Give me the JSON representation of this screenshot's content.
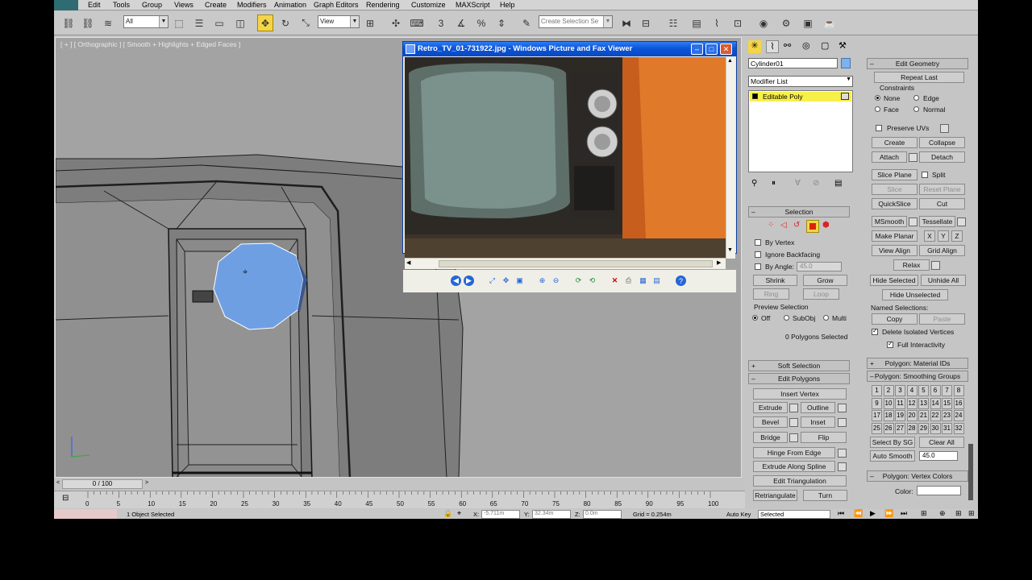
{
  "menu": [
    "Edit",
    "Tools",
    "Group",
    "Views",
    "Create",
    "Modifiers",
    "Animation",
    "Graph Editors",
    "Rendering",
    "Customize",
    "MAXScript",
    "Help"
  ],
  "toolbar": {
    "filter_value": "All",
    "refcoord_value": "View",
    "selection_set_placeholder": "Create Selection Se"
  },
  "viewport": {
    "label": "[ + ] [ Orthographic ] [ Smooth + Highlights + Edged Faces ]"
  },
  "picture_viewer": {
    "title": "Retro_TV_01-731922.jpg - Windows Picture and Fax Viewer"
  },
  "command_panel": {
    "object_name": "Cylinder01",
    "modifier_list": "Modifier List",
    "stack_item": "Editable Poly",
    "selection": {
      "header": "Selection",
      "by_vertex": "By Vertex",
      "ignore_backfacing": "Ignore Backfacing",
      "by_angle": "By Angle:",
      "by_angle_value": "45.0",
      "shrink": "Shrink",
      "grow": "Grow",
      "ring": "Ring",
      "loop": "Loop",
      "preview_selection": "Preview Selection",
      "preview_off": "Off",
      "preview_subobj": "SubObj",
      "preview_multi": "Multi",
      "status": "0 Polygons Selected"
    },
    "soft_selection": "Soft Selection",
    "edit_polygons": {
      "header": "Edit Polygons",
      "insert_vertex": "Insert Vertex",
      "extrude": "Extrude",
      "outline": "Outline",
      "bevel": "Bevel",
      "inset": "Inset",
      "bridge": "Bridge",
      "flip": "Flip",
      "hinge": "Hinge From Edge",
      "extrude_spline": "Extrude Along Spline",
      "edit_triangulation": "Edit Triangulation",
      "retriangulate": "Retriangulate",
      "turn": "Turn"
    },
    "edit_geometry": {
      "header": "Edit Geometry",
      "repeat_last": "Repeat Last",
      "constraints": "Constraints",
      "c_none": "None",
      "c_edge": "Edge",
      "c_face": "Face",
      "c_normal": "Normal",
      "preserve_uvs": "Preserve UVs",
      "create": "Create",
      "collapse": "Collapse",
      "attach": "Attach",
      "detach": "Detach",
      "slice_plane": "Slice Plane",
      "split": "Split",
      "slice": "Slice",
      "reset_plane": "Reset Plane",
      "quickslice": "QuickSlice",
      "cut": "Cut",
      "msmooth": "MSmooth",
      "tessellate": "Tessellate",
      "make_planar": "Make Planar",
      "x": "X",
      "y": "Y",
      "z": "Z",
      "view_align": "View Align",
      "grid_align": "Grid Align",
      "relax": "Relax",
      "hide_selected": "Hide Selected",
      "unhide_all": "Unhide All",
      "hide_unselected": "Hide Unselected",
      "named_selections": "Named Selections:",
      "copy": "Copy",
      "paste": "Paste",
      "delete_isolated": "Delete Isolated Vertices",
      "full_interactivity": "Full Interactivity"
    },
    "material_ids": "Polygon: Material IDs",
    "smoothing_groups": {
      "header": "Polygon: Smoothing Groups",
      "numbers": [
        "1",
        "2",
        "3",
        "4",
        "5",
        "6",
        "7",
        "8",
        "9",
        "10",
        "11",
        "12",
        "13",
        "14",
        "15",
        "16",
        "17",
        "18",
        "19",
        "20",
        "21",
        "22",
        "23",
        "24",
        "25",
        "26",
        "27",
        "28",
        "29",
        "30",
        "31",
        "32"
      ],
      "select_by_sg": "Select By SG",
      "clear_all": "Clear All",
      "auto_smooth": "Auto Smooth",
      "auto_smooth_value": "45.0"
    },
    "vertex_colors": {
      "header": "Polygon: Vertex Colors",
      "color": "Color:"
    }
  },
  "timeline": {
    "frame": "0 / 100",
    "ticks": [
      "0",
      "5",
      "10",
      "15",
      "20",
      "25",
      "30",
      "35",
      "40",
      "45",
      "50",
      "55",
      "60",
      "65",
      "70",
      "75",
      "80",
      "85",
      "90",
      "95",
      "100"
    ]
  },
  "status": {
    "selected": "1 Object Selected",
    "x_label": "X:",
    "x_value": "-5.711m",
    "y_label": "Y:",
    "y_value": "32.34m",
    "z_label": "Z:",
    "z_value": "0.0m",
    "grid": "Grid = 0.254m",
    "auto_key": "Auto Key",
    "key_filter": "Selected"
  },
  "colors": {
    "selected_poly": "#6f9fe3",
    "active_tool": "#f4d548",
    "stack_highlight": "#f7ef4a",
    "xp_title": "#0a55d8"
  }
}
